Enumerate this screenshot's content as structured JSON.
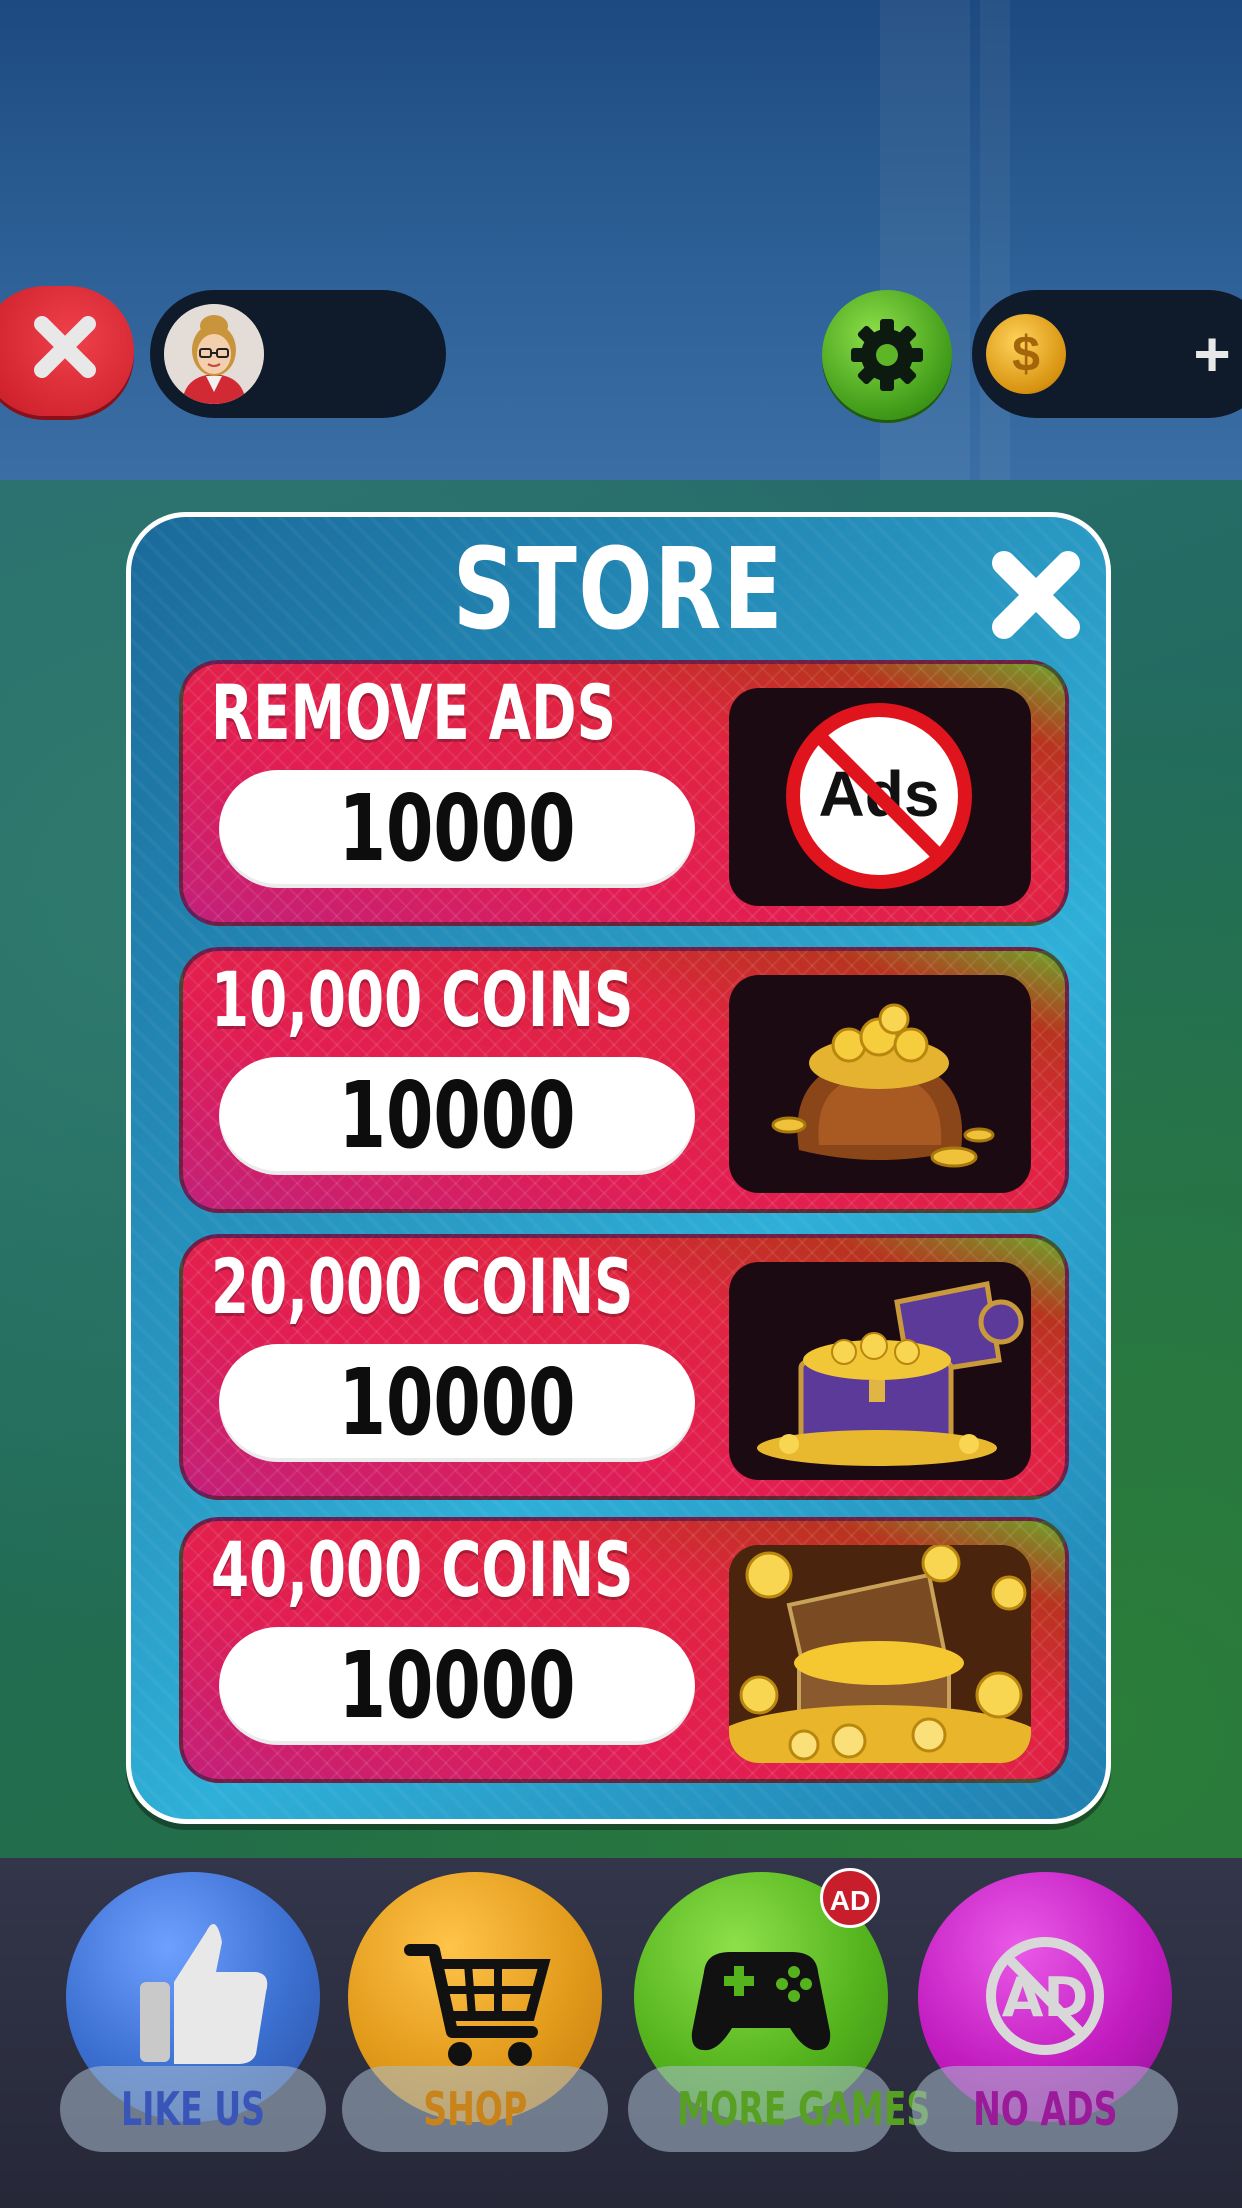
{
  "hud": {
    "close_icon": "x-icon",
    "avatar_icon": "avatar-woman-glasses",
    "settings_icon": "gear-icon",
    "coin_symbol": "$",
    "plus_label": "+"
  },
  "store": {
    "title": "STORE",
    "close_icon": "x-icon",
    "items": [
      {
        "title": "REMOVE ADS",
        "price": "10000",
        "image": "no-ads-icon",
        "image_text": "Ads"
      },
      {
        "title": "10,000 COINS",
        "price": "10000",
        "image": "coin-bag-icon"
      },
      {
        "title": "20,000 COINS",
        "price": "10000",
        "image": "treasure-chest-icon"
      },
      {
        "title": "40,000 COINS",
        "price": "10000",
        "image": "big-treasure-icon"
      }
    ]
  },
  "nav": {
    "items": [
      {
        "label": "LIKE US",
        "icon": "thumbs-up-icon",
        "color": "#3b6fd0",
        "label_color": "#3a55b8"
      },
      {
        "label": "SHOP",
        "icon": "cart-icon",
        "color": "#e29a1a",
        "label_color": "#c8841a"
      },
      {
        "label": "MORE GAMES",
        "icon": "gamepad-icon",
        "color": "#55b41e",
        "label_color": "#58a024",
        "badge": "AD"
      },
      {
        "label": "NO ADS",
        "icon": "no-ad-icon",
        "color": "#c21cc0",
        "label_color": "#9a1a9a",
        "icon_text": "AD"
      }
    ]
  }
}
